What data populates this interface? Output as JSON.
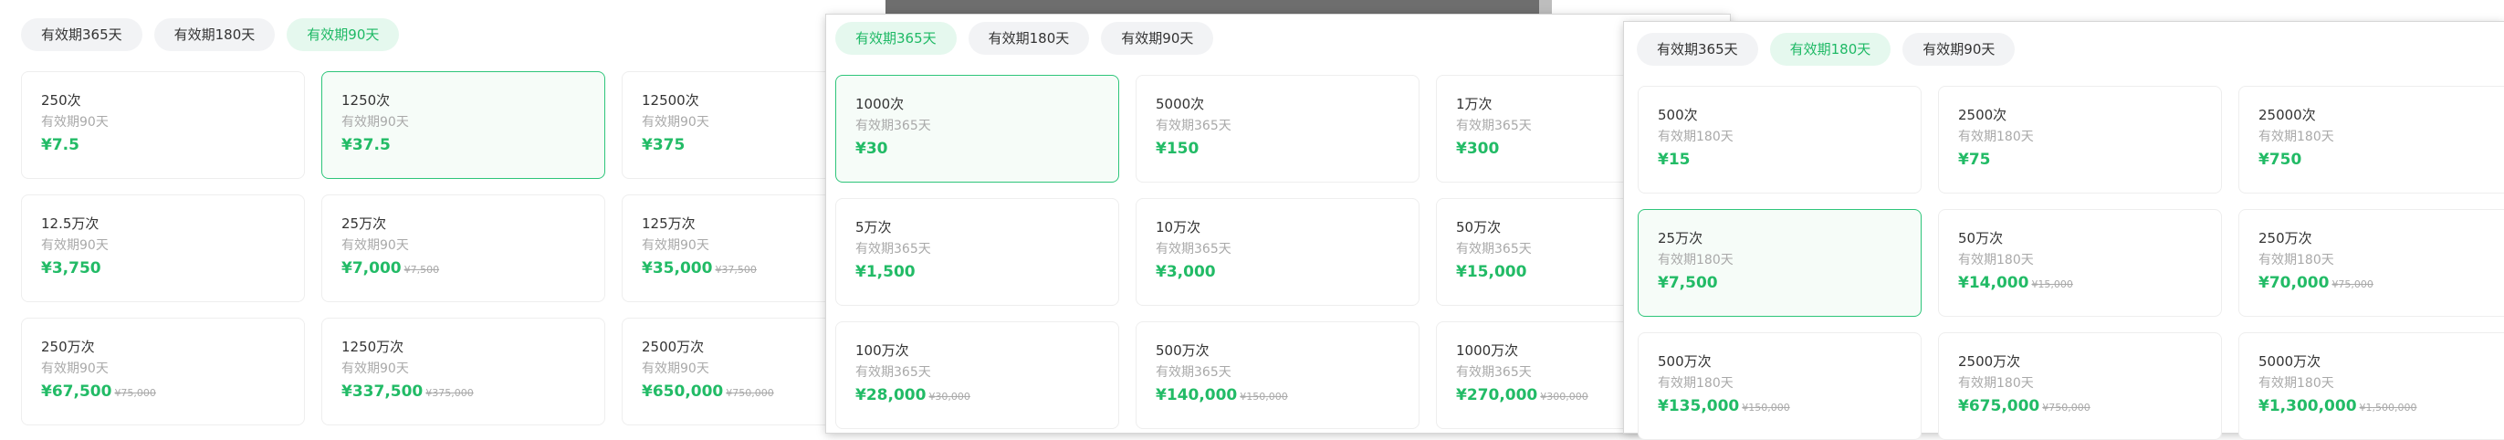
{
  "panels": [
    {
      "tabs": [
        "有效期365天",
        "有效期180天",
        "有效期90天"
      ],
      "active_tab": 2,
      "selected_card": 1,
      "cards": [
        {
          "count": "250次",
          "validity": "有效期90天",
          "price": "¥7.5",
          "original": ""
        },
        {
          "count": "1250次",
          "validity": "有效期90天",
          "price": "¥37.5",
          "original": ""
        },
        {
          "count": "12500次",
          "validity": "有效期90天",
          "price": "¥375",
          "original": ""
        },
        {
          "count": "12.5万次",
          "validity": "有效期90天",
          "price": "¥3,750",
          "original": ""
        },
        {
          "count": "25万次",
          "validity": "有效期90天",
          "price": "¥7,000",
          "original": "¥7,500"
        },
        {
          "count": "125万次",
          "validity": "有效期90天",
          "price": "¥35,000",
          "original": "¥37,500"
        },
        {
          "count": "250万次",
          "validity": "有效期90天",
          "price": "¥67,500",
          "original": "¥75,000"
        },
        {
          "count": "1250万次",
          "validity": "有效期90天",
          "price": "¥337,500",
          "original": "¥375,000"
        },
        {
          "count": "2500万次",
          "validity": "有效期90天",
          "price": "¥650,000",
          "original": "¥750,000"
        }
      ]
    },
    {
      "tabs": [
        "有效期365天",
        "有效期180天",
        "有效期90天"
      ],
      "active_tab": 0,
      "selected_card": 0,
      "cards": [
        {
          "count": "1000次",
          "validity": "有效期365天",
          "price": "¥30",
          "original": ""
        },
        {
          "count": "5000次",
          "validity": "有效期365天",
          "price": "¥150",
          "original": ""
        },
        {
          "count": "1万次",
          "validity": "有效期365天",
          "price": "¥300",
          "original": ""
        },
        {
          "count": "5万次",
          "validity": "有效期365天",
          "price": "¥1,500",
          "original": ""
        },
        {
          "count": "10万次",
          "validity": "有效期365天",
          "price": "¥3,000",
          "original": ""
        },
        {
          "count": "50万次",
          "validity": "有效期365天",
          "price": "¥15,000",
          "original": ""
        },
        {
          "count": "100万次",
          "validity": "有效期365天",
          "price": "¥28,000",
          "original": "¥30,000"
        },
        {
          "count": "500万次",
          "validity": "有效期365天",
          "price": "¥140,000",
          "original": "¥150,000"
        },
        {
          "count": "1000万次",
          "validity": "有效期365天",
          "price": "¥270,000",
          "original": "¥300,000"
        }
      ]
    },
    {
      "tabs": [
        "有效期365天",
        "有效期180天",
        "有效期90天"
      ],
      "active_tab": 1,
      "selected_card": 3,
      "cards": [
        {
          "count": "500次",
          "validity": "有效期180天",
          "price": "¥15",
          "original": ""
        },
        {
          "count": "2500次",
          "validity": "有效期180天",
          "price": "¥75",
          "original": ""
        },
        {
          "count": "25000次",
          "validity": "有效期180天",
          "price": "¥750",
          "original": ""
        },
        {
          "count": "25万次",
          "validity": "有效期180天",
          "price": "¥7,500",
          "original": ""
        },
        {
          "count": "50万次",
          "validity": "有效期180天",
          "price": "¥14,000",
          "original": "¥15,000"
        },
        {
          "count": "250万次",
          "validity": "有效期180天",
          "price": "¥70,000",
          "original": "¥75,000"
        },
        {
          "count": "500万次",
          "validity": "有效期180天",
          "price": "¥135,000",
          "original": "¥150,000"
        },
        {
          "count": "2500万次",
          "validity": "有效期180天",
          "price": "¥675,000",
          "original": "¥750,000"
        },
        {
          "count": "5000万次",
          "validity": "有效期180天",
          "price": "¥1,300,000",
          "original": "¥1,500,000"
        }
      ]
    }
  ]
}
